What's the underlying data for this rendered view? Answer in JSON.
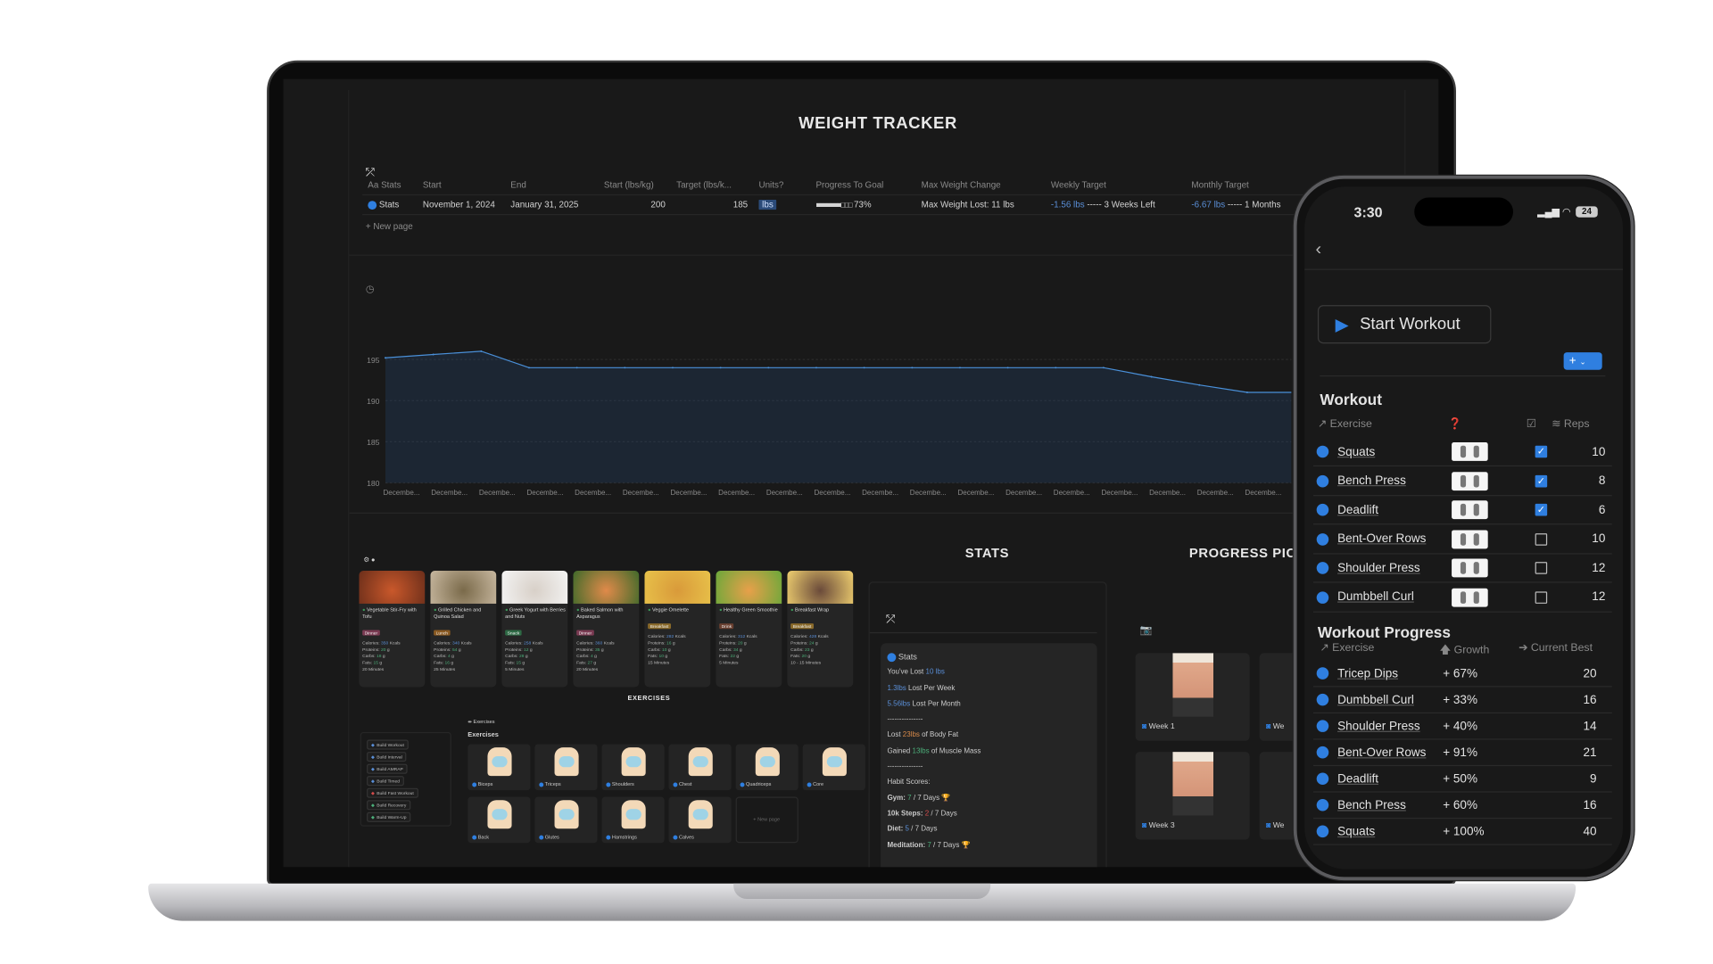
{
  "laptop": {
    "title": "WEIGHT TRACKER",
    "table": {
      "headers": [
        "Aa Stats",
        "Start",
        "End",
        "Start (lbs/kg)",
        "Target (lbs/k...",
        "Units?",
        "Progress To Goal",
        "Max Weight Change",
        "Weekly Target",
        "Monthly Target"
      ],
      "row": {
        "name": "Stats",
        "start": "November 1, 2024",
        "end": "January 31, 2025",
        "start_weight": "200",
        "target_weight": "185",
        "units": "lbs",
        "progress_bar": "■■■■■■■□□□",
        "progress_pct": "73%",
        "progress_value": 0.73,
        "max_weight_change": "Max Weight Lost: 11 lbs",
        "weekly_value": "-1.56 lbs",
        "weekly_rest": "-----  3 Weeks Left",
        "monthly_value": "-6.67 lbs",
        "monthly_rest": "----- 1 Months"
      },
      "new_page": "+ New page"
    },
    "chart_data": {
      "type": "area",
      "categories": [
        "Decembe...",
        "Decembe...",
        "Decembe...",
        "Decembe...",
        "Decembe...",
        "Decembe...",
        "Decembe...",
        "Decembe...",
        "Decembe...",
        "Decembe...",
        "Decembe...",
        "Decembe...",
        "Decembe...",
        "Decembe...",
        "Decembe...",
        "Decembe...",
        "Decembe...",
        "Decembe...",
        "Decembe..."
      ],
      "values": [
        195.2,
        195.6,
        196,
        194,
        194,
        194,
        194,
        194,
        194,
        194,
        194,
        194,
        194,
        194,
        194,
        194,
        192.9,
        191.9,
        191
      ],
      "yticks": [
        "180",
        "185",
        "190",
        "195"
      ],
      "ylim": [
        180,
        197.5
      ],
      "color": "#4a90d9",
      "grid": true
    },
    "meals": [
      {
        "name": "Vegetable Stir-Fry with Tofu",
        "tag": "Dinner",
        "tag_color": "#7a3a52",
        "calories": "350",
        "proteins": "20",
        "carbs": "18",
        "fats": "15",
        "time": "20 Minutes",
        "img": [
          "#6b2e1a",
          "#c9582b"
        ]
      },
      {
        "name": "Grilled Chicken and Quinoa Salad",
        "tag": "Lunch",
        "tag_color": "#8a5a22",
        "calories": "340",
        "proteins": "54",
        "carbs": "4",
        "fats": "16",
        "time": "25 Minutes",
        "img": [
          "#c8b8a0",
          "#7a6a4a"
        ]
      },
      {
        "name": "Greek Yogurt with Berries and Nuts",
        "tag": "Snack",
        "tag_color": "#2e6a45",
        "calories": "258",
        "proteins": "12",
        "carbs": "28",
        "fats": "15",
        "time": "5 Minutes",
        "img": [
          "#f4f4f4",
          "#d8d0c8"
        ]
      },
      {
        "name": "Baked Salmon with Asparagus",
        "tag": "Dinner",
        "tag_color": "#7a3a52",
        "calories": "360",
        "proteins": "35",
        "carbs": "4",
        "fats": "27",
        "time": "20 Minutes",
        "img": [
          "#3f6a2a",
          "#e08a4a"
        ]
      },
      {
        "name": "Veggie Omelette",
        "tag": "Breakfast",
        "tag_color": "#8a6a2a",
        "calories": "282",
        "proteins": "16",
        "carbs": "10",
        "fats": "10",
        "time": "15 Minutes",
        "img": [
          "#e8c24a",
          "#d99a3a"
        ]
      },
      {
        "name": "Healthy Green Smoothie",
        "tag": "Drink",
        "tag_color": "#6a4030",
        "calories": "312",
        "proteins": "20",
        "carbs": "34",
        "fats": "22",
        "time": "5 Minutes",
        "img": [
          "#6aa83a",
          "#e8a04a"
        ]
      },
      {
        "name": "Breakfast Wrap",
        "tag": "Breakfast",
        "tag_color": "#8a6a2a",
        "calories": "428",
        "proteins": "24",
        "carbs": "23",
        "fats": "20",
        "time": "10 - 15 Minutes",
        "img": [
          "#f0d070",
          "#6a4a3a"
        ]
      }
    ],
    "meal_labels": {
      "calories": "Calories:",
      "kcal": "Kcals",
      "proteins": "Proteins:",
      "carbs": "Carbs:",
      "fats": "Fats:",
      "g": "g"
    },
    "exercises_title": "EXERCISES",
    "exercises_db": "Exercises",
    "exercises_heading": "Exercises",
    "build_buttons": [
      "Build Workout",
      "Build Interval",
      "Build AMRAP",
      "Build Timed",
      "Build Fast Workout",
      "Build Recovery",
      "Build Warm-Up"
    ],
    "muscles": [
      "Biceps",
      "Triceps",
      "Shoulders",
      "Chest",
      "Quadriceps",
      "Core",
      "Back",
      "Glutes",
      "Hamstrings",
      "Calves"
    ],
    "new_page_tile": "+ New page",
    "stats_title": "STATS",
    "stats_card_title": "Stats",
    "stats_lines": [
      [
        {
          "t": "You've Lost "
        },
        {
          "t": "10 lbs",
          "c": "blue"
        }
      ],
      [
        {
          "t": "1.3lbs",
          "c": "blue"
        },
        {
          "t": " Lost Per Week"
        }
      ],
      [
        {
          "t": "5.56lbs",
          "c": "blue"
        },
        {
          "t": " Lost Per Month"
        }
      ],
      [
        {
          "t": "---------------"
        }
      ],
      [
        {
          "t": "Lost "
        },
        {
          "t": "23lbs",
          "c": "orange"
        },
        {
          "t": " of Body Fat"
        }
      ],
      [
        {
          "t": "Gained "
        },
        {
          "t": "13lbs",
          "c": "green"
        },
        {
          "t": " of Muscle Mass"
        }
      ],
      [
        {
          "t": "---------------"
        }
      ],
      [
        {
          "t": "Habit Scores:"
        }
      ],
      [
        {
          "t": "Gym: ",
          "b": true
        },
        {
          "t": "7",
          "c": "green"
        },
        {
          "t": " / 7 Days 🏆"
        }
      ],
      [
        {
          "t": "10k Steps: ",
          "b": true
        },
        {
          "t": "2",
          "c": "red"
        },
        {
          "t": " / 7 Days"
        }
      ],
      [
        {
          "t": "Diet: ",
          "b": true
        },
        {
          "t": "5",
          "c": "blue"
        },
        {
          "t": " / 7 Days"
        }
      ],
      [
        {
          "t": "Meditation: ",
          "b": true
        },
        {
          "t": "7",
          "c": "green"
        },
        {
          "t": " / 7 Days 🏆"
        }
      ]
    ],
    "progress_title": "PROGRESS PIC",
    "progress_pics": [
      "Week 1",
      "We",
      "Week 3",
      "We"
    ]
  },
  "phone": {
    "time": "3:30",
    "battery": "24",
    "start_workout": "Start Workout",
    "workout_title": "Workout",
    "workout_headers": {
      "exercise": "Exercise",
      "reps": "Reps"
    },
    "workout": [
      {
        "name": "Squats",
        "done": true,
        "reps": "10"
      },
      {
        "name": "Bench Press",
        "done": true,
        "reps": "8"
      },
      {
        "name": "Deadlift",
        "done": true,
        "reps": "6"
      },
      {
        "name": "Bent-Over Rows",
        "done": false,
        "reps": "10"
      },
      {
        "name": "Shoulder Press",
        "done": false,
        "reps": "12"
      },
      {
        "name": "Dumbbell Curl",
        "done": false,
        "reps": "12"
      }
    ],
    "progress_title": "Workout Progress",
    "progress_headers": {
      "exercise": "Exercise",
      "growth": "Growth",
      "best": "Current Best"
    },
    "progress": [
      {
        "name": "Tricep Dips",
        "growth": "+ 67%",
        "best": "20"
      },
      {
        "name": "Dumbbell Curl",
        "growth": "+ 33%",
        "best": "16"
      },
      {
        "name": "Shoulder Press",
        "growth": "+ 40%",
        "best": "14"
      },
      {
        "name": "Bent-Over Rows",
        "growth": "+ 91%",
        "best": "21"
      },
      {
        "name": "Deadlift",
        "growth": "+ 50%",
        "best": "9"
      },
      {
        "name": "Bench Press",
        "growth": "+ 60%",
        "best": "16"
      },
      {
        "name": "Squats",
        "growth": "+ 100%",
        "best": "40"
      }
    ]
  }
}
